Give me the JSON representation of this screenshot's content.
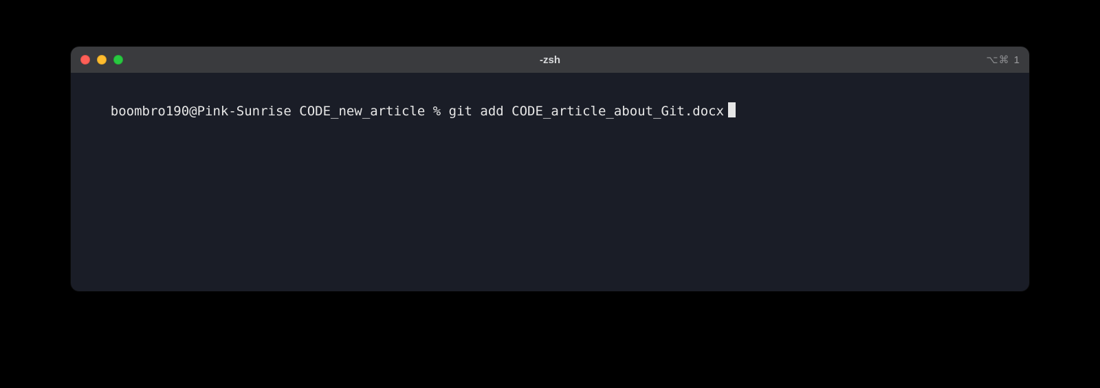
{
  "window": {
    "title": "-zsh",
    "shortcut_hint": {
      "symbols": "⌥⌘",
      "number": "1"
    }
  },
  "terminal": {
    "prompt": "boombro190@Pink-Sunrise CODE_new_article % ",
    "command": "git add CODE_article_about_Git.docx"
  }
}
